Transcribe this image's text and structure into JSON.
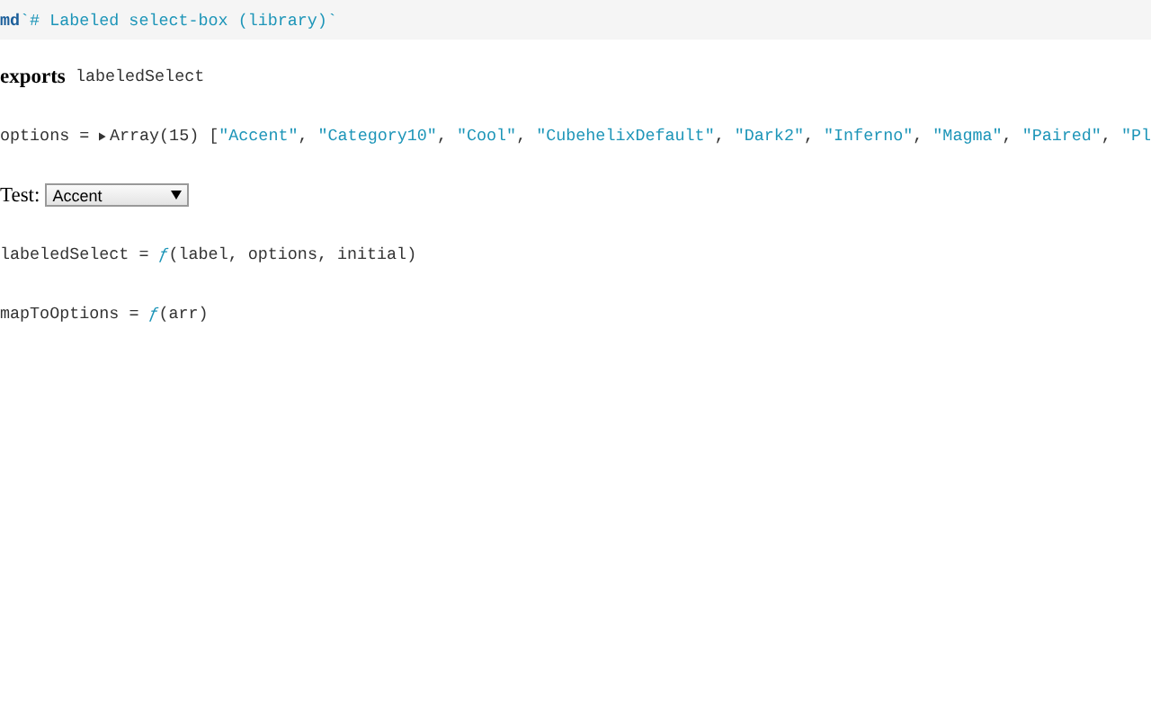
{
  "header_cell": {
    "tag": "md",
    "source": "`# Labeled select-box (library)`"
  },
  "cells": [
    {
      "kind": "exports",
      "keyword": "exports",
      "name": "labeledSelect"
    },
    {
      "kind": "array",
      "name": "options",
      "equals": "=",
      "prefix": "Array(15) [",
      "separator": ",",
      "items": [
        "\"Accent\"",
        "\"Category10\"",
        "\"Cool\"",
        "\"CubehelixDefault\"",
        "\"Dark2\"",
        "\"Inferno\"",
        "\"Magma\"",
        "\"Paired\"",
        "\"Pl"
      ]
    },
    {
      "kind": "select",
      "label": "Test:",
      "value": "Accent"
    },
    {
      "kind": "function",
      "name": "labeledSelect",
      "equals": "=",
      "f": "ƒ",
      "args": "(label, options, initial)"
    },
    {
      "kind": "function",
      "name": "mapToOptions",
      "equals": "=",
      "f": "ƒ",
      "args": "(arr)"
    }
  ]
}
